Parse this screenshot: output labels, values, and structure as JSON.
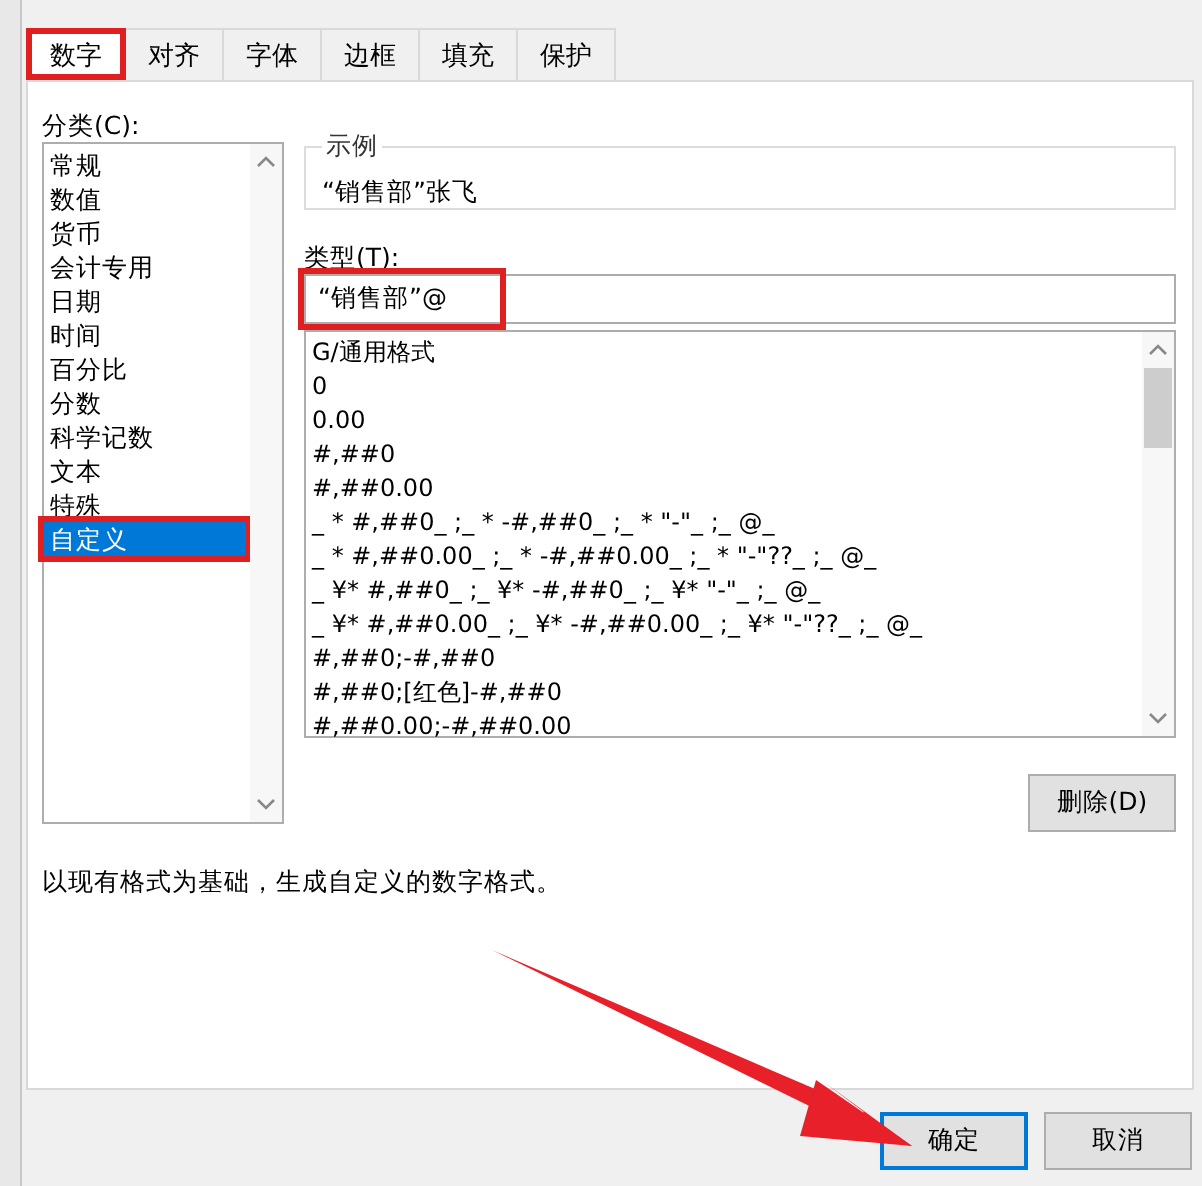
{
  "tabs": [
    {
      "label": "数字",
      "selected": true,
      "highlighted": true
    },
    {
      "label": "对齐",
      "selected": false,
      "highlighted": false
    },
    {
      "label": "字体",
      "selected": false,
      "highlighted": false
    },
    {
      "label": "边框",
      "selected": false,
      "highlighted": false
    },
    {
      "label": "填充",
      "selected": false,
      "highlighted": false
    },
    {
      "label": "保护",
      "selected": false,
      "highlighted": false
    }
  ],
  "category": {
    "label": "分类(C):",
    "items": [
      {
        "label": "常规",
        "selected": false,
        "highlighted": false
      },
      {
        "label": "数值",
        "selected": false,
        "highlighted": false
      },
      {
        "label": "货币",
        "selected": false,
        "highlighted": false
      },
      {
        "label": "会计专用",
        "selected": false,
        "highlighted": false
      },
      {
        "label": "日期",
        "selected": false,
        "highlighted": false
      },
      {
        "label": "时间",
        "selected": false,
        "highlighted": false
      },
      {
        "label": "百分比",
        "selected": false,
        "highlighted": false
      },
      {
        "label": "分数",
        "selected": false,
        "highlighted": false
      },
      {
        "label": "科学记数",
        "selected": false,
        "highlighted": false
      },
      {
        "label": "文本",
        "selected": false,
        "highlighted": false
      },
      {
        "label": "特殊",
        "selected": false,
        "highlighted": false
      },
      {
        "label": "自定义",
        "selected": true,
        "highlighted": true
      }
    ]
  },
  "sample": {
    "title": "示例",
    "value": "“销售部”张飞"
  },
  "type": {
    "label": "类型(T):",
    "value": "“销售部”@",
    "highlighted": true
  },
  "formats": [
    "G/通用格式",
    "0",
    "0.00",
    "#,##0",
    "#,##0.00",
    "_ * #,##0_ ;_ * -#,##0_ ;_ * \"-\"_ ;_ @_",
    "_ * #,##0.00_ ;_ * -#,##0.00_ ;_ * \"-\"??_ ;_ @_",
    "_ ¥* #,##0_ ;_ ¥* -#,##0_ ;_ ¥* \"-\"_ ;_ @_",
    "_ ¥* #,##0.00_ ;_ ¥* -#,##0.00_ ;_ ¥* \"-\"??_ ;_ @_",
    "#,##0;-#,##0",
    "#,##0;[红色]-#,##0",
    "#,##0.00;-#,##0.00"
  ],
  "delete_button": "删除(D)",
  "description": "以现有格式为基础，生成自定义的数字格式。",
  "buttons": [
    {
      "label": "确定",
      "kind": "default"
    },
    {
      "label": "取消",
      "kind": "normal"
    }
  ]
}
